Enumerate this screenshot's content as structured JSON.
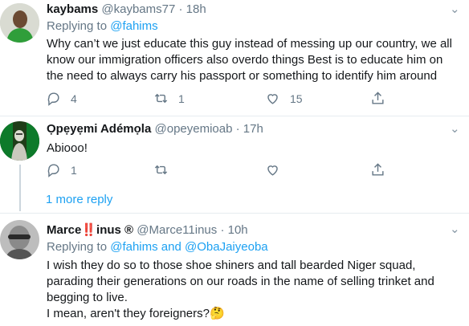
{
  "tweets": [
    {
      "name": "kaybams",
      "handle": "@kaybams77",
      "sep": "·",
      "time": "18h",
      "replying_prefix": "Replying to ",
      "replying_to": "@fahims",
      "replying_and": "",
      "replying_to2": "",
      "lines": [
        "Why can’t we just educate this guy instead of messing up our country, we all",
        "know our immigration officers also overdo things Best is to educate him on",
        "the need to always carry his passport or something to identify him around"
      ],
      "replies": "4",
      "retweets": "1",
      "likes": "15"
    },
    {
      "name": "Ọpẹyẹmi Adémọla",
      "handle": "@opeyemioab",
      "sep": "·",
      "time": "17h",
      "lines": [
        "Abiooo!"
      ],
      "replies": "1",
      "retweets": "",
      "likes": ""
    },
    {
      "name": "Marce",
      "name_emoji": "‼️",
      "name_rest": "inus ®",
      "handle": "@Marce11inus",
      "sep": "·",
      "time": "10h",
      "replying_prefix": "Replying to ",
      "replying_to": "@fahims",
      "replying_and": " and ",
      "replying_to2": "@ObaJaiyeoba",
      "lines": [
        "I wish they do so to those shoe shiners and tall bearded Niger squad,",
        "parading their generations on our roads in the name of selling trinket and",
        "begging to live.",
        "I mean, aren't they foreigners?🤔"
      ]
    }
  ],
  "more_replies": "1 more reply",
  "icons": {
    "reply": "reply-icon",
    "retweet": "retweet-icon",
    "like": "heart-icon",
    "share": "share-icon",
    "caret": "chevron-down-icon"
  },
  "colors": {
    "link": "#1da1f2",
    "muted": "#657786",
    "divider": "#e6ecf0"
  }
}
